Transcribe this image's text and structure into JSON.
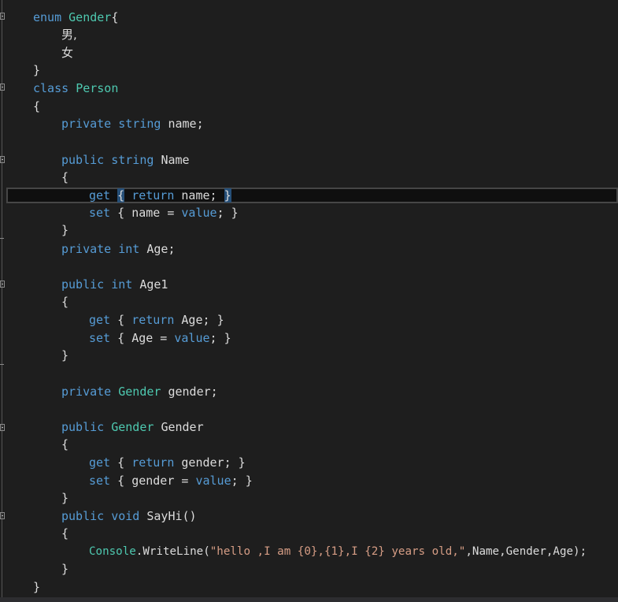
{
  "code": {
    "l1": {
      "kw": "enum",
      "type": "Gender",
      "punct": "{"
    },
    "l2": {
      "text": "男,"
    },
    "l3": {
      "text": "女"
    },
    "l4": {
      "text": "}"
    },
    "l5": {
      "kw": "class",
      "type": "Person"
    },
    "l6": {
      "text": "{"
    },
    "l7": {
      "kw1": "private",
      "kw2": "string",
      "rest": "name;"
    },
    "l9": {
      "kw1": "public",
      "kw2": "string",
      "rest": "Name"
    },
    "l10": {
      "text": "{"
    },
    "l11": {
      "kw1": "get",
      "brace_open": "{",
      "kw2": "return",
      "rest": "name;",
      "brace_close": "}"
    },
    "l12": {
      "kw1": "set",
      "brace_open": "{",
      "mid": "name =",
      "kw2": "value",
      "rest": ";",
      "brace_close": "}"
    },
    "l13": {
      "text": "}"
    },
    "l14": {
      "kw1": "private",
      "kw2": "int",
      "rest": "Age;"
    },
    "l16": {
      "kw1": "public",
      "kw2": "int",
      "rest": "Age1"
    },
    "l17": {
      "text": "{"
    },
    "l18": {
      "kw1": "get",
      "brace_open": "{",
      "kw2": "return",
      "rest": "Age;",
      "brace_close": "}"
    },
    "l19": {
      "kw1": "set",
      "brace_open": "{",
      "mid": "Age =",
      "kw2": "value",
      "rest": ";",
      "brace_close": "}"
    },
    "l20": {
      "text": "}"
    },
    "l22": {
      "kw1": "private",
      "type": "Gender",
      "rest": "gender;"
    },
    "l24": {
      "kw1": "public",
      "type": "Gender",
      "rest": "Gender"
    },
    "l25": {
      "text": "{"
    },
    "l26": {
      "kw1": "get",
      "brace_open": "{",
      "kw2": "return",
      "rest": "gender;",
      "brace_close": "}"
    },
    "l27": {
      "kw1": "set",
      "brace_open": "{",
      "mid": "gender =",
      "kw2": "value",
      "rest": ";",
      "brace_close": "}"
    },
    "l28": {
      "text": "}"
    },
    "l29": {
      "kw1": "public",
      "kw2": "void",
      "rest": "SayHi()"
    },
    "l30": {
      "text": "{"
    },
    "l31": {
      "type": "Console",
      "method": ".WriteLine(",
      "str": "\"hello ,I am {0},{1},I {2} years old,\"",
      "rest": ",Name,Gender,Age);"
    },
    "l32": {
      "text": "}"
    },
    "l33": {
      "text": "}"
    }
  },
  "colors": {
    "keyword": "#569cd6",
    "type": "#4ec9b0",
    "string": "#d69d85",
    "text": "#dcdcdc",
    "background": "#1e1e1e",
    "brace_highlight": "#264f78"
  },
  "icons": [
    "fold-collapse-icon"
  ]
}
